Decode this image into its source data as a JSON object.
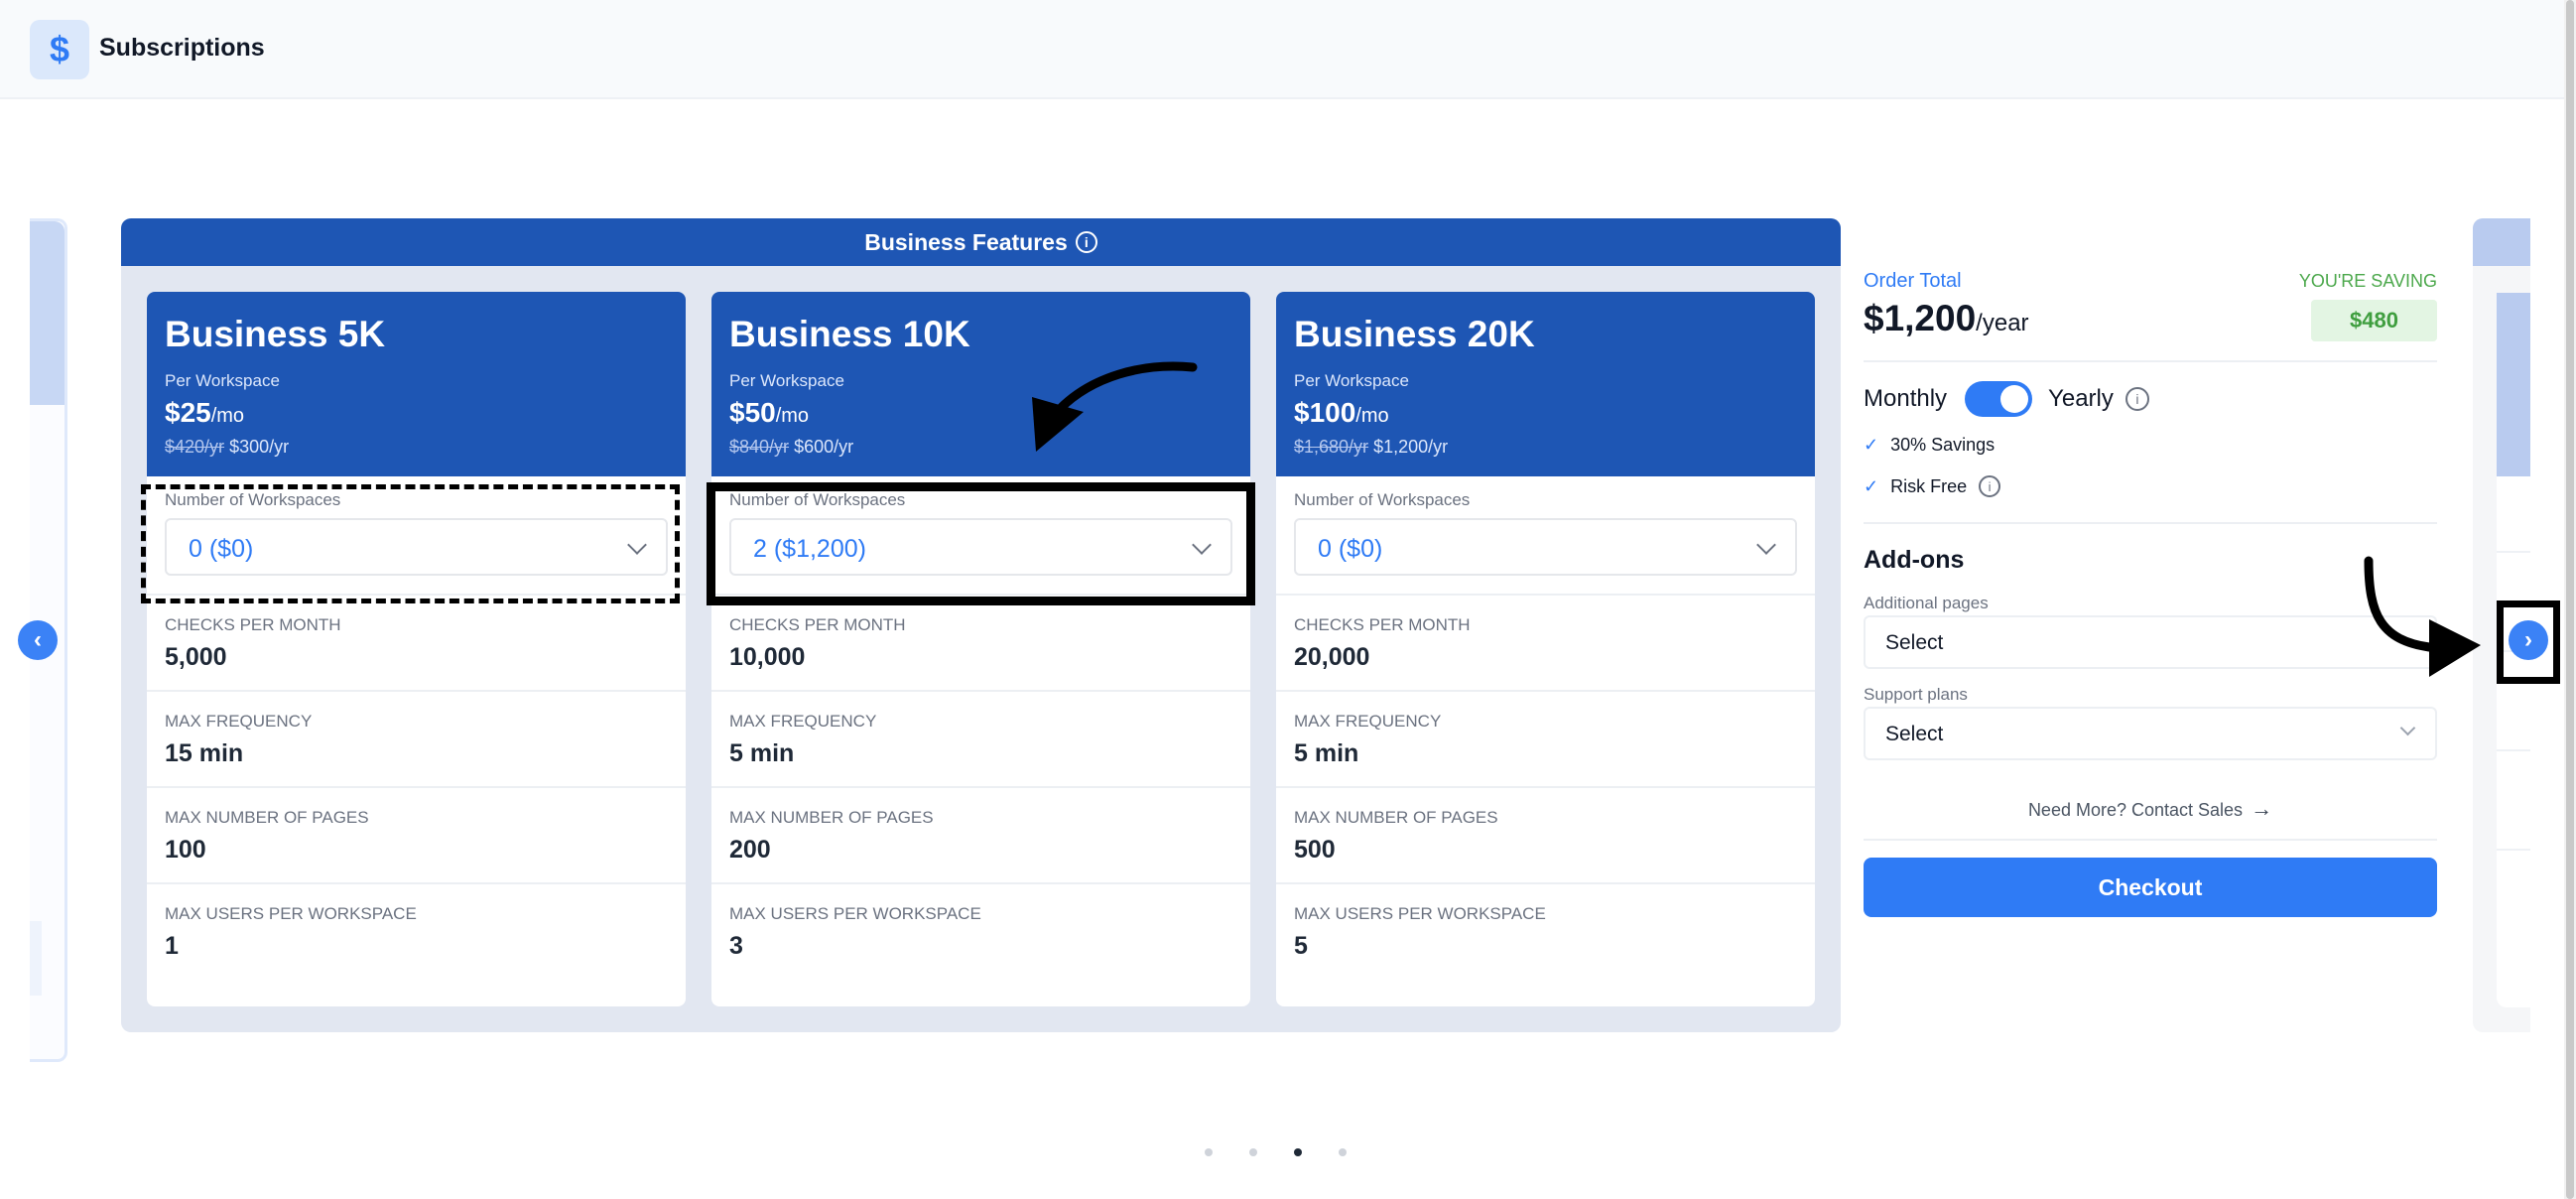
{
  "header": {
    "title": "Subscriptions",
    "logo_glyph": "$"
  },
  "features": {
    "heading": "Business Features",
    "info_glyph": "i",
    "plans": [
      {
        "name": "Business 5K",
        "per_workspace": "Per Workspace",
        "price": "$25",
        "price_unit": "/mo",
        "old_yearly": "$420/yr",
        "yearly": "$300/yr",
        "ws_label": "Number of Workspaces",
        "ws_value": "0 ($0)",
        "rows": [
          {
            "label": "CHECKS PER MONTH",
            "value": "5,000"
          },
          {
            "label": "MAX FREQUENCY",
            "value": "15 min"
          },
          {
            "label": "MAX NUMBER OF PAGES",
            "value": "100"
          },
          {
            "label": "MAX USERS PER WORKSPACE",
            "value": "1"
          }
        ]
      },
      {
        "name": "Business 10K",
        "per_workspace": "Per Workspace",
        "price": "$50",
        "price_unit": "/mo",
        "old_yearly": "$840/yr",
        "yearly": "$600/yr",
        "ws_label": "Number of Workspaces",
        "ws_value": "2 ($1,200)",
        "rows": [
          {
            "label": "CHECKS PER MONTH",
            "value": "10,000"
          },
          {
            "label": "MAX FREQUENCY",
            "value": "5 min"
          },
          {
            "label": "MAX NUMBER OF PAGES",
            "value": "200"
          },
          {
            "label": "MAX USERS PER WORKSPACE",
            "value": "3"
          }
        ]
      },
      {
        "name": "Business 20K",
        "per_workspace": "Per Workspace",
        "price": "$100",
        "price_unit": "/mo",
        "old_yearly": "$1,680/yr",
        "yearly": "$1,200/yr",
        "ws_label": "Number of Workspaces",
        "ws_value": "0 ($0)",
        "rows": [
          {
            "label": "CHECKS PER MONTH",
            "value": "20,000"
          },
          {
            "label": "MAX FREQUENCY",
            "value": "5 min"
          },
          {
            "label": "MAX NUMBER OF PAGES",
            "value": "500"
          },
          {
            "label": "MAX USERS PER WORKSPACE",
            "value": "5"
          }
        ]
      }
    ]
  },
  "order": {
    "label": "Order Total",
    "total": "$1,200",
    "total_unit": "/year",
    "saving_label": "YOU'RE SAVING",
    "saving_value": "$480",
    "billing_monthly": "Monthly",
    "billing_yearly": "Yearly",
    "billing_info": "i",
    "checks": [
      {
        "text": "30% Savings",
        "glyph": "✓"
      },
      {
        "text": "Risk Free",
        "glyph": "✓",
        "info": "i"
      }
    ],
    "addons_title": "Add-ons",
    "additional_pages_label": "Additional pages",
    "additional_pages_value": "Select",
    "support_plans_label": "Support plans",
    "support_plans_value": "Select",
    "contact_text": "Need More? Contact Sales",
    "contact_arrow": "→",
    "checkout_label": "Checkout"
  },
  "carousel": {
    "prev_glyph": "‹",
    "next_glyph": "›",
    "dot_count": 4,
    "active_dot": 3
  },
  "colors": {
    "brand_blue": "#1e56b4",
    "accent_blue": "#2f7bf5",
    "saving_green": "#3f9e3f"
  }
}
